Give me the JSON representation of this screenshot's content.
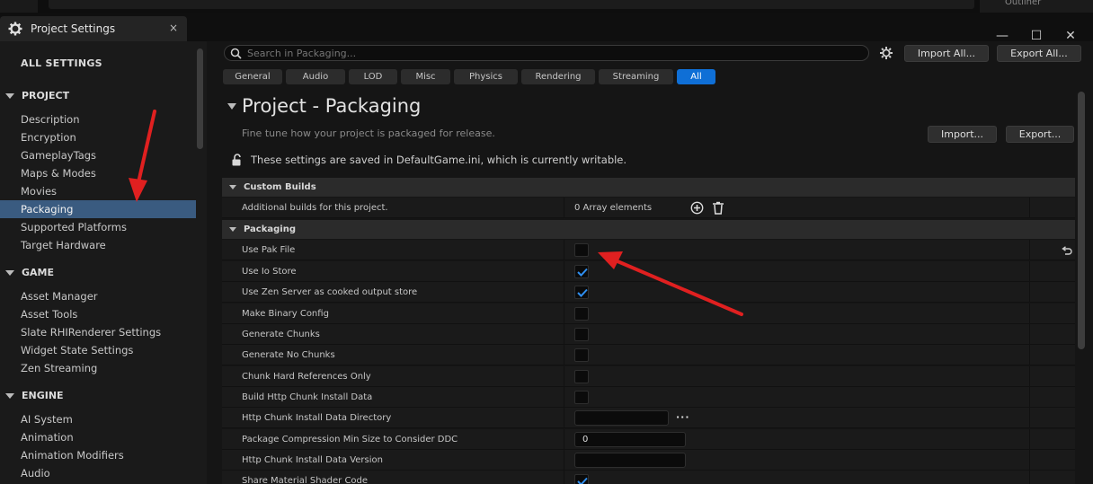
{
  "topbar": {
    "outliner_label": "Outliner"
  },
  "window": {
    "tab_title": "Project Settings",
    "close_glyph": "×",
    "minimize_glyph": "—",
    "maximize_glyph": "☐",
    "close_window_glyph": "✕"
  },
  "sidebar": {
    "all_settings": "ALL SETTINGS",
    "sections": [
      {
        "label": "PROJECT",
        "items": [
          "Description",
          "Encryption",
          "GameplayTags",
          "Maps & Modes",
          "Movies",
          "Packaging",
          "Supported Platforms",
          "Target Hardware"
        ]
      },
      {
        "label": "GAME",
        "items": [
          "Asset Manager",
          "Asset Tools",
          "Slate RHIRenderer Settings",
          "Widget State Settings",
          "Zen Streaming"
        ]
      },
      {
        "label": "ENGINE",
        "items": [
          "AI System",
          "Animation",
          "Animation Modifiers",
          "Audio"
        ]
      }
    ],
    "selected": "Packaging"
  },
  "toolbar": {
    "search_placeholder": "Search in Packaging...",
    "import_all": "Import All...",
    "export_all": "Export All...",
    "filter_tabs": [
      "General",
      "Audio",
      "LOD",
      "Misc",
      "Physics",
      "Rendering",
      "Streaming",
      "All"
    ],
    "active_filter": "All"
  },
  "page": {
    "title": "Project - Packaging",
    "subtitle": "Fine tune how your project is packaged for release.",
    "import": "Import...",
    "export": "Export...",
    "writable_note": "These settings are saved in DefaultGame.ini, which is currently writable."
  },
  "categories": {
    "custom_builds": {
      "label": "Custom Builds",
      "row_label": "Additional builds for this project.",
      "row_value": "0 Array elements"
    },
    "packaging": {
      "label": "Packaging",
      "rows": [
        {
          "label": "Use Pak File",
          "type": "checkbox",
          "checked": false,
          "resettable": true
        },
        {
          "label": "Use Io Store",
          "type": "checkbox",
          "checked": true
        },
        {
          "label": "Use Zen Server as cooked output store",
          "type": "checkbox",
          "checked": true
        },
        {
          "label": "Make Binary Config",
          "type": "checkbox",
          "checked": false
        },
        {
          "label": "Generate Chunks",
          "type": "checkbox",
          "checked": false
        },
        {
          "label": "Generate No Chunks",
          "type": "checkbox",
          "checked": false
        },
        {
          "label": "Chunk Hard References Only",
          "type": "checkbox",
          "checked": false
        },
        {
          "label": "Build Http Chunk Install Data",
          "type": "checkbox",
          "checked": false
        },
        {
          "label": "Http Chunk Install Data Directory",
          "type": "path",
          "value": ""
        },
        {
          "label": "Package Compression Min Size to Consider DDC",
          "type": "text",
          "value": "0"
        },
        {
          "label": "Http Chunk Install Data Version",
          "type": "text",
          "value": ""
        },
        {
          "label": "Share Material Shader Code",
          "type": "checkbox",
          "checked": true
        }
      ]
    }
  },
  "colors": {
    "accent": "#0f6fd6",
    "selection": "#3a5b80",
    "annotation_arrow": "#e02020",
    "check": "#2f8ff0"
  }
}
